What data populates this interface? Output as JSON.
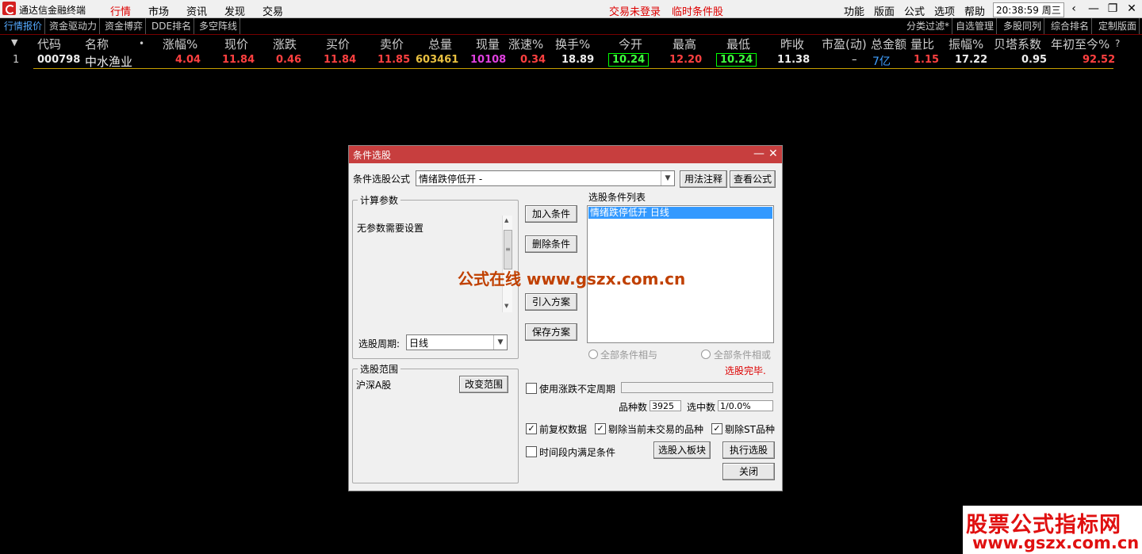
{
  "app": {
    "title": "通达信金融终端"
  },
  "menu": {
    "items": [
      "行情",
      "市场",
      "资讯",
      "发现",
      "交易"
    ],
    "active": "行情",
    "center_links": [
      "交易未登录",
      "临时条件股"
    ],
    "right_items": [
      "功能",
      "版面",
      "公式",
      "选项",
      "帮助"
    ],
    "clock": "20:38:59",
    "weekday": "周三",
    "window_buttons": [
      "‹",
      "—",
      "❐",
      "✕"
    ]
  },
  "tabs": {
    "left": [
      "行情报价",
      "资金驱动力",
      "资金博弈",
      "DDE排名",
      "多空阵线"
    ],
    "right": [
      "分类过滤*",
      "自选管理",
      "多股同列",
      "综合排名",
      "定制版面"
    ]
  },
  "table": {
    "headers": [
      "代码",
      "名称",
      "•",
      "涨幅%",
      "现价",
      "涨跌",
      "买价",
      "卖价",
      "总量",
      "现量",
      "涨速%",
      "换手%",
      "今开",
      "最高",
      "最低",
      "昨收",
      "市盈(动)",
      "总金额",
      "量比",
      "振幅%",
      "贝塔系数",
      "年初至今%",
      "?"
    ],
    "row": {
      "index": "1",
      "code": "000798",
      "name": "中水渔业",
      "pct": "4.04",
      "price": "11.84",
      "change": "0.46",
      "bid": "11.84",
      "ask": "11.85",
      "volume": "603461",
      "cur_vol": "10108",
      "speed": "0.34",
      "turnover": "18.89",
      "open": "10.24",
      "high": "12.20",
      "low": "10.24",
      "prev_close": "11.38",
      "pe": "–",
      "amount": "7亿",
      "vol_ratio": "1.15",
      "amplitude": "17.22",
      "beta": "0.95",
      "ytd": "92.52"
    }
  },
  "dialog": {
    "title": "条件选股",
    "formula_label": "条件选股公式",
    "formula_value": "情绪跌停低开 -",
    "btn_usage": "用法注释",
    "btn_view": "查看公式",
    "params_legend": "计算参数",
    "params_text": "无参数需要设置",
    "period_label": "选股周期:",
    "period_value": "日线",
    "btn_add": "加入条件",
    "btn_delete": "删除条件",
    "btn_import": "引入方案",
    "btn_save": "保存方案",
    "cond_list_label": "选股条件列表",
    "cond_items": [
      "情绪跌停低开  日线"
    ],
    "radio_and": "全部条件相与",
    "radio_or": "全部条件相或",
    "status": "选股完毕.",
    "range_legend": "选股范围",
    "range_value": "沪深A股",
    "btn_range": "改变范围",
    "chk_irregular": "使用涨跌不定周期",
    "count_label": "品种数",
    "count_value": "3925",
    "selected_label": "选中数",
    "selected_value": "1/0.0%",
    "chk_adjust": "前复权数据",
    "chk_exclude_suspended": "剔除当前未交易的品种",
    "chk_exclude_st": "剔除ST品种",
    "chk_time_period": "时间段内满足条件",
    "btn_to_block": "选股入板块",
    "btn_run": "执行选股",
    "btn_close": "关闭",
    "ctl_minimize": "—",
    "ctl_close": "✕"
  },
  "watermarks": {
    "center": "公式在线 www.gszx.com.cn",
    "corner_title": "股票公式指标网",
    "corner_url": "www.gszx.com.cn"
  }
}
